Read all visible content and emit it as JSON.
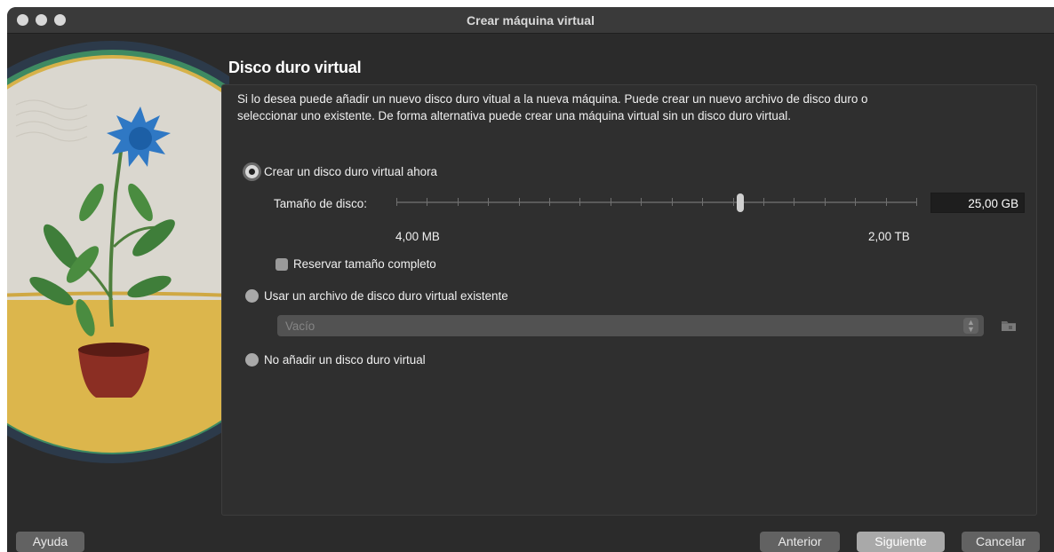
{
  "window": {
    "title": "Crear máquina virtual"
  },
  "page": {
    "heading": "Disco duro virtual",
    "description": "Si lo desea puede añadir un nuevo disco duro vitual a la nueva máquina. Puede crear un nuevo archivo de disco duro o seleccionar uno existente. De forma alternativa puede crear una máquina virtual sin un disco duro virtual."
  },
  "options": {
    "create_now": {
      "label": "Crear un disco duro virtual ahora",
      "checked": true
    },
    "use_existing": {
      "label": "Usar un archivo de disco duro virtual existente",
      "checked": false
    },
    "none": {
      "label": "No añadir un disco duro virtual",
      "checked": false
    }
  },
  "disk_size": {
    "label": "Tamaño de disco:",
    "value": "25,00 GB",
    "min_label": "4,00 MB",
    "max_label": "2,00 TB",
    "slider_fraction": 0.66,
    "tick_count": 18
  },
  "preallocate": {
    "label": "Reservar tamaño completo",
    "checked": false
  },
  "existing_file": {
    "value": "Vacío"
  },
  "icons": {
    "combo": "chevron-up-down-icon",
    "folder": "folder-icon"
  },
  "buttons": {
    "help": "Ayuda",
    "back": "Anterior",
    "next": "Siguiente",
    "cancel": "Cancelar"
  },
  "colors": {
    "window_bg": "#2b2b2b",
    "panel_bg": "#2f2f2f",
    "primary_button": "#a9a9a9"
  }
}
